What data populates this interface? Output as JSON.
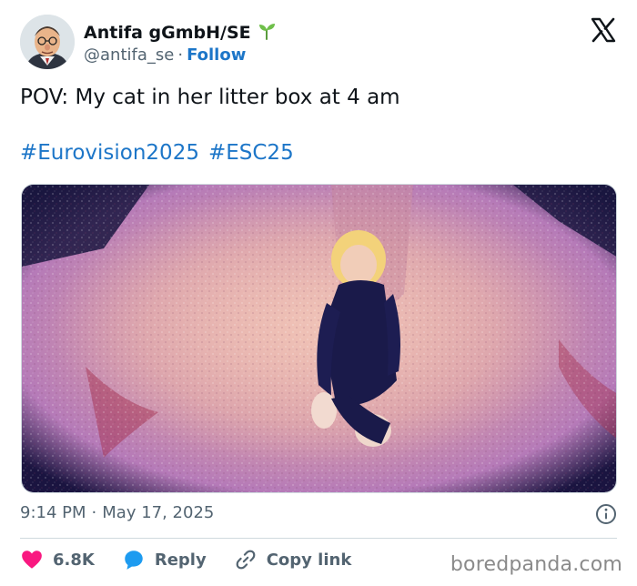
{
  "author": {
    "display_name": "Antifa gGmbH/SE",
    "handle": "@antifa_se",
    "separator": "·",
    "follow_label": "Follow",
    "badge_icon": "seedling-icon"
  },
  "platform_logo": "x-logo-icon",
  "tweet": {
    "text": "POV: My cat in her litter box at 4 am",
    "hashtags": [
      "#Eurovision2025",
      "#ESC25"
    ]
  },
  "media": {
    "description_icon": "photo-icon"
  },
  "meta": {
    "time": "9:14 PM",
    "separator": "·",
    "date": "May 17, 2025"
  },
  "actions": {
    "likes": "6.8K",
    "reply_label": "Reply",
    "copy_label": "Copy link"
  },
  "watermark": "boredpanda.com",
  "colors": {
    "link": "#1d76c8",
    "heart": "#f91880",
    "reply_bubble": "#1d9bf0",
    "muted": "#536471"
  }
}
